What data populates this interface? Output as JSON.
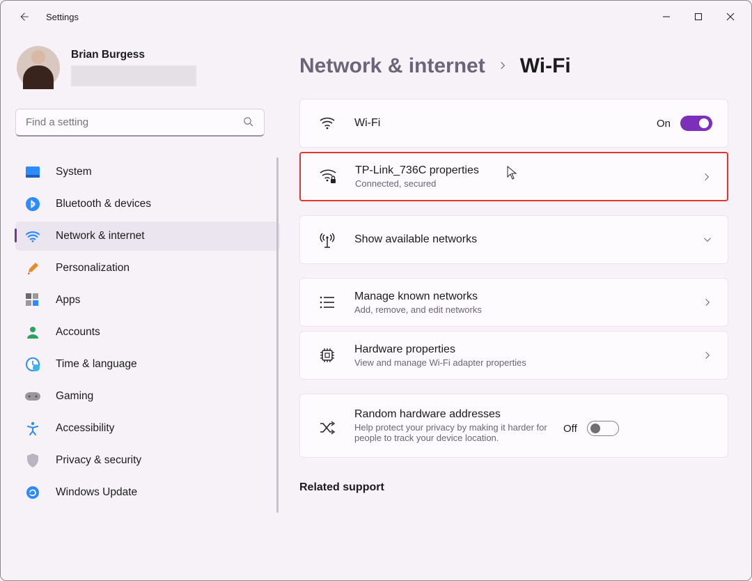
{
  "window": {
    "title": "Settings"
  },
  "profile": {
    "name": "Brian Burgess"
  },
  "search": {
    "placeholder": "Find a setting"
  },
  "sidebar": {
    "items": [
      {
        "label": "System"
      },
      {
        "label": "Bluetooth & devices"
      },
      {
        "label": "Network & internet"
      },
      {
        "label": "Personalization"
      },
      {
        "label": "Apps"
      },
      {
        "label": "Accounts"
      },
      {
        "label": "Time & language"
      },
      {
        "label": "Gaming"
      },
      {
        "label": "Accessibility"
      },
      {
        "label": "Privacy & security"
      },
      {
        "label": "Windows Update"
      }
    ]
  },
  "breadcrumb": {
    "parent": "Network & internet",
    "current": "Wi-Fi"
  },
  "cards": {
    "wifi": {
      "title": "Wi-Fi",
      "state_label": "On"
    },
    "network_props": {
      "title": "TP-Link_736C properties",
      "subtitle": "Connected, secured"
    },
    "available": {
      "title": "Show available networks"
    },
    "known": {
      "title": "Manage known networks",
      "subtitle": "Add, remove, and edit networks"
    },
    "hardware": {
      "title": "Hardware properties",
      "subtitle": "View and manage Wi-Fi adapter properties"
    },
    "random": {
      "title": "Random hardware addresses",
      "subtitle": "Help protect your privacy by making it harder for people to track your device location.",
      "state_label": "Off"
    }
  },
  "related": {
    "heading": "Related support"
  }
}
